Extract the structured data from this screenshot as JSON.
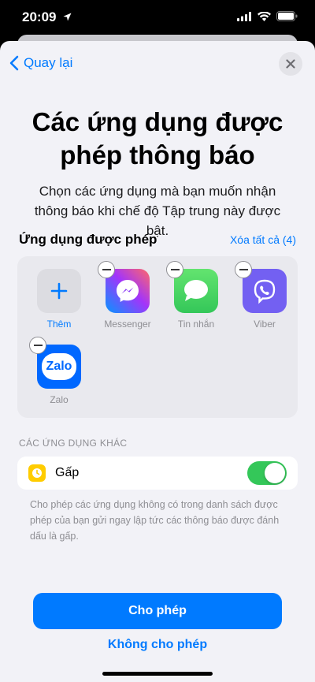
{
  "status_bar": {
    "time": "20:09"
  },
  "nav": {
    "back_label": "Quay lại"
  },
  "header": {
    "title": "Các ứng dụng được phép thông báo",
    "subtitle": "Chọn các ứng dụng mà bạn muốn nhận thông báo khi chế độ Tập trung này được bật."
  },
  "allowed_section": {
    "title": "Ứng dụng được phép",
    "clear_all_label": "Xóa tất cả (4)",
    "add_label": "Thêm",
    "apps": [
      {
        "name": "Messenger",
        "icon": "messenger-icon"
      },
      {
        "name": "Tin nhắn",
        "icon": "messages-icon"
      },
      {
        "name": "Viber",
        "icon": "viber-icon"
      },
      {
        "name": "Zalo",
        "icon": "zalo-icon",
        "icon_text": "Zalo"
      }
    ]
  },
  "other_section": {
    "title": "CÁC ỨNG DỤNG KHÁC",
    "urgent_label": "Gấp",
    "urgent_enabled": true,
    "description": "Cho phép các ứng dụng không có trong danh sách được phép của bạn gửi ngay lập tức các thông báo được đánh dấu là gấp."
  },
  "actions": {
    "allow_label": "Cho phép",
    "deny_label": "Không cho phép"
  },
  "colors": {
    "accent": "#007aff",
    "toggle_on": "#34c759",
    "sheet_bg": "#f2f2f7"
  }
}
